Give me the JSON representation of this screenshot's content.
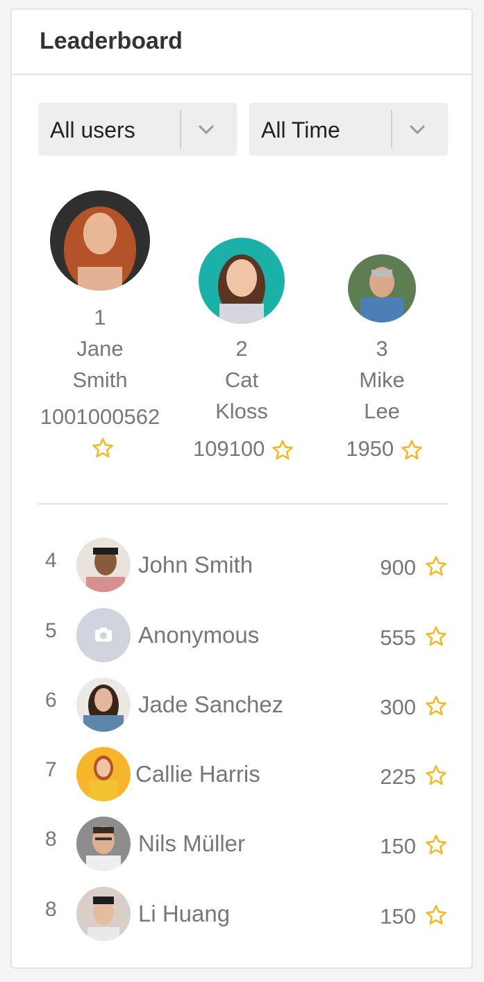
{
  "header": {
    "title": "Leaderboard"
  },
  "filters": {
    "users": {
      "value": "All users",
      "icon": "chevron-down-icon"
    },
    "period": {
      "value": "All Time",
      "icon": "chevron-down-icon"
    }
  },
  "colors": {
    "star": "#f3b823",
    "text": "#777777",
    "accent_teal": "#1bb0a8"
  },
  "top3": [
    {
      "rank": "1",
      "first": "Jane",
      "last": "Smith",
      "score": "1001000562"
    },
    {
      "rank": "2",
      "first": "Cat",
      "last": "Kloss",
      "score": "109100"
    },
    {
      "rank": "3",
      "first": "Mike",
      "last": "Lee",
      "score": "1950"
    }
  ],
  "rows": [
    {
      "rank": "4",
      "name": "John Smith",
      "score": "900"
    },
    {
      "rank": "5",
      "name": "Anonymous",
      "score": "555"
    },
    {
      "rank": "6",
      "name": "Jade Sanchez",
      "score": "300"
    },
    {
      "rank": "7",
      "name": "Callie Harris",
      "score": "225"
    },
    {
      "rank": "8",
      "name": "Nils Müller",
      "score": "150"
    },
    {
      "rank": "8",
      "name": "Li Huang",
      "score": "150"
    }
  ]
}
